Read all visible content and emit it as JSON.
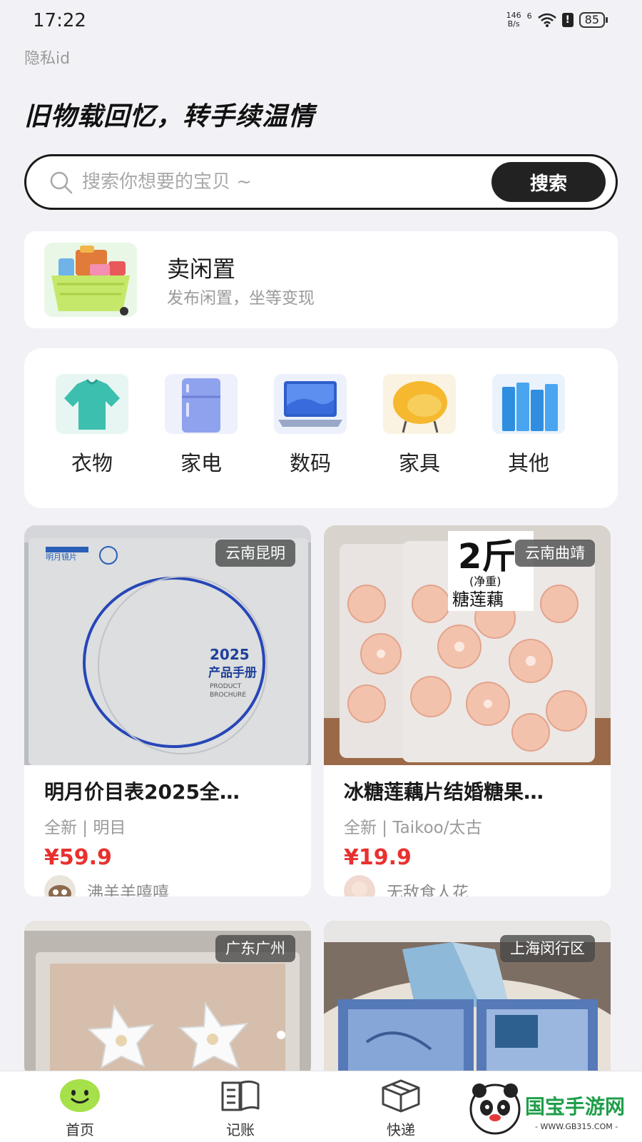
{
  "status_bar": {
    "time": "17:22",
    "net_speed_top": "146",
    "net_speed_bottom": "B/s",
    "signal_label": "6",
    "battery": "85"
  },
  "header": {
    "privacy_label": "隐私id",
    "slogan": "旧物载回忆，转手续温情"
  },
  "search": {
    "placeholder": "搜索你想要的宝贝 ~",
    "button_label": "搜索"
  },
  "sell": {
    "title": "卖闲置",
    "subtitle": "发布闲置，坐等变现"
  },
  "categories": [
    {
      "label": "衣物",
      "icon": "tshirt-icon"
    },
    {
      "label": "家电",
      "icon": "fridge-icon"
    },
    {
      "label": "数码",
      "icon": "laptop-icon"
    },
    {
      "label": "家具",
      "icon": "chair-icon"
    },
    {
      "label": "其他",
      "icon": "books-icon"
    }
  ],
  "products": [
    {
      "location": "云南昆明",
      "title": "明月价目表2025全…",
      "tag": "全新 | 明目",
      "price": "¥59.9",
      "seller": "沸羊羊嘻嘻",
      "image_text": {
        "year": "2025",
        "caption": "产品手册",
        "en1": "PRODUCT",
        "en2": "BROCHURE",
        "brand": "明月镜片"
      }
    },
    {
      "location": "云南曲靖",
      "title": "冰糖莲藕片结婚糖果…",
      "tag": "全新 | Taikoo/太古",
      "price": "¥19.9",
      "seller": "无敌食人花",
      "image_text": {
        "weight": "2斤",
        "net": "(净重)",
        "name": "糖莲藕"
      }
    },
    {
      "location": "广东广州"
    },
    {
      "location": "上海闵行区"
    }
  ],
  "nav": [
    {
      "label": "首页",
      "icon": "smiley-icon"
    },
    {
      "label": "记账",
      "icon": "ledger-icon"
    },
    {
      "label": "快递",
      "icon": "package-icon"
    }
  ],
  "watermark": {
    "brand": "国宝手游网",
    "url": "- WWW.GB315.COM -"
  },
  "colors": {
    "accent_price": "#e8312f",
    "search_button": "#222222",
    "background": "#f2f2f6"
  }
}
